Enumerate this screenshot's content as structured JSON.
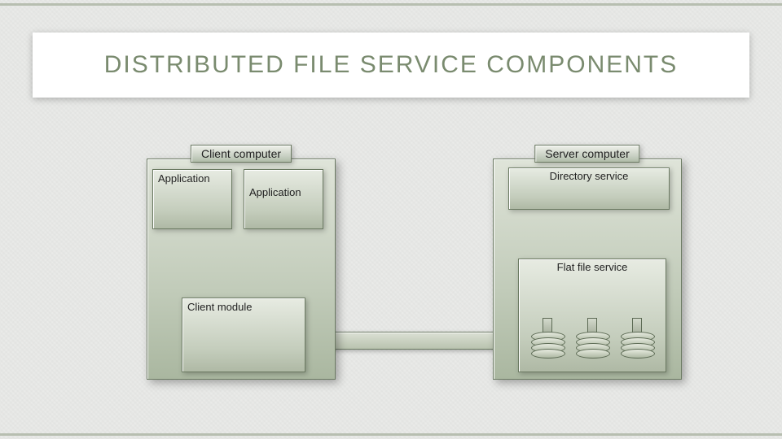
{
  "title": "DISTRIBUTED FILE SERVICE COMPONENTS",
  "client": {
    "header": "Client computer",
    "app1": "Application",
    "app2": "Application",
    "module": "Client module"
  },
  "server": {
    "header": "Server computer",
    "directory": "Directory service",
    "flatfile": "Flat file service"
  }
}
